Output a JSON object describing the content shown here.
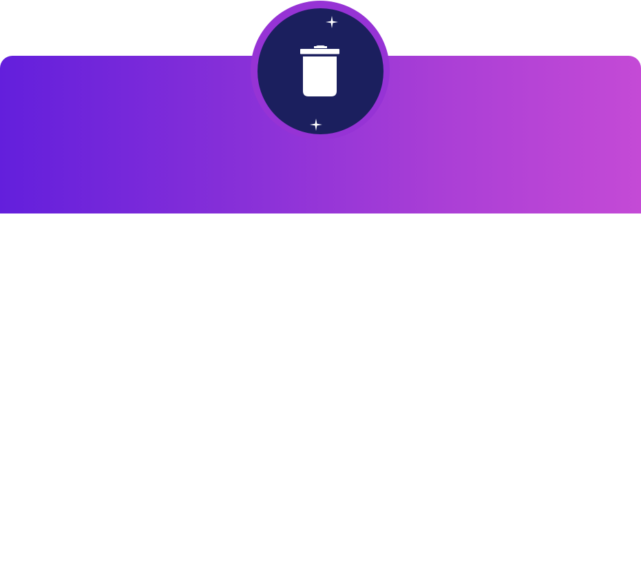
{
  "header": {
    "gradient_start": "#631fdc",
    "gradient_end": "#c44ad6"
  },
  "badge": {
    "icon": "trash-icon",
    "decorations": [
      "sparkle-icon",
      "sparkle-icon"
    ],
    "ring_color": "#9633d5",
    "core_color": "#1b1f5e",
    "icon_color": "#ffffff"
  }
}
